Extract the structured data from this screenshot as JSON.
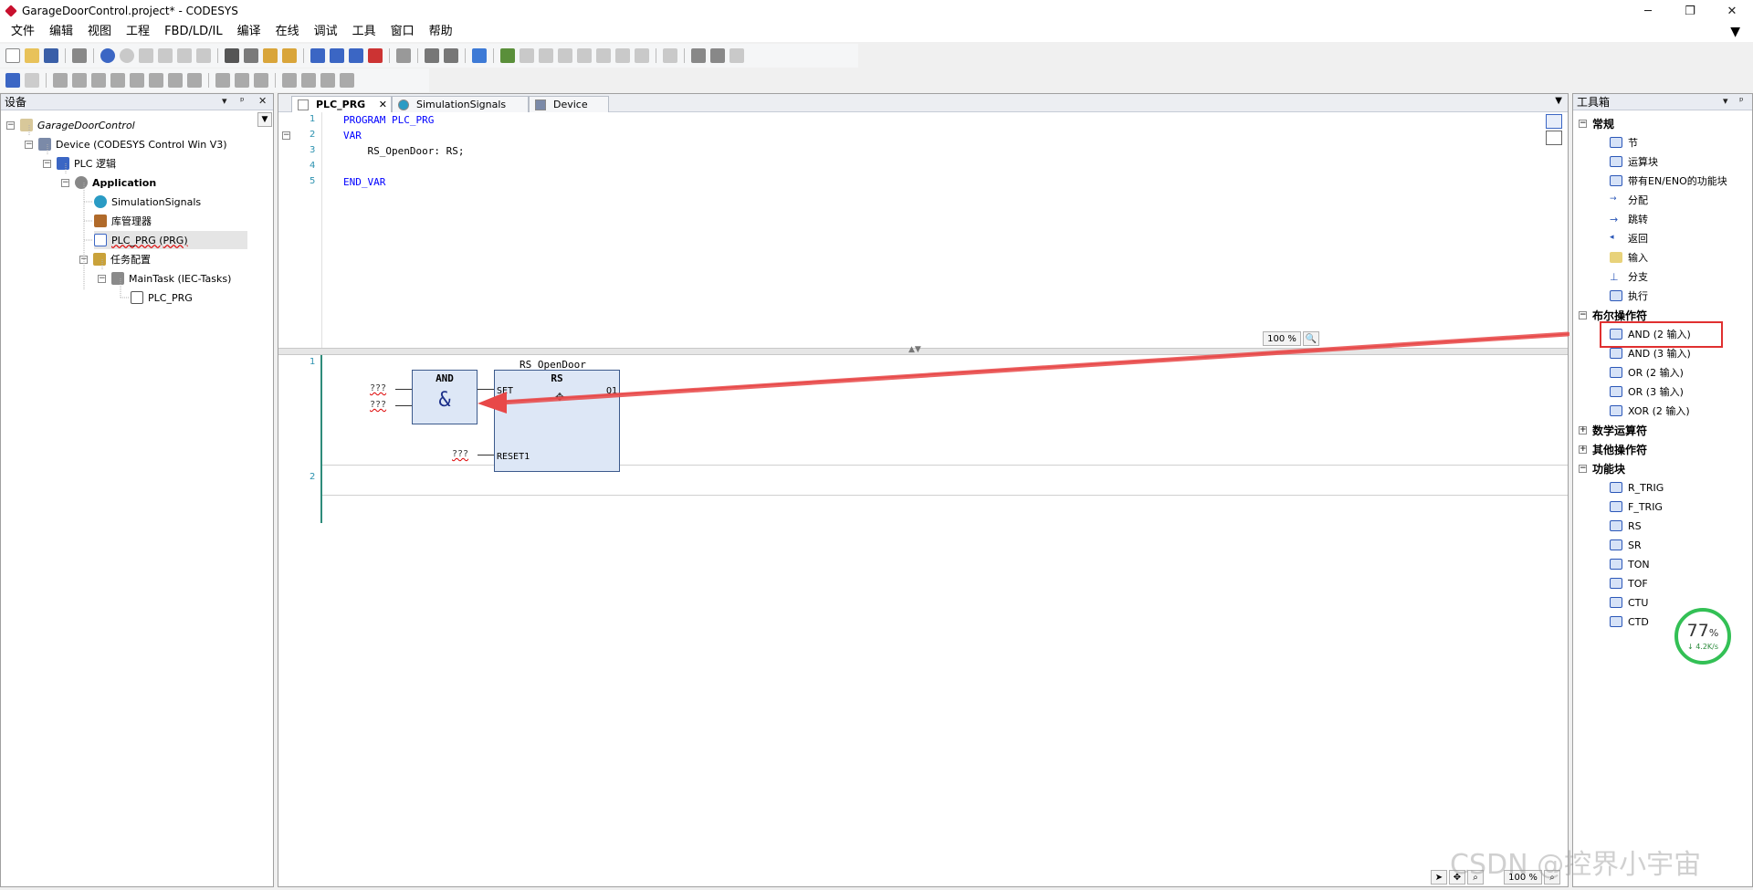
{
  "window": {
    "title": "GarageDoorControl.project* - CODESYS",
    "minimize": "─",
    "maximize": "❐",
    "close": "✕"
  },
  "menu": [
    "文件",
    "编辑",
    "视图",
    "工程",
    "FBD/LD/IL",
    "编译",
    "在线",
    "调试",
    "工具",
    "窗口",
    "帮助"
  ],
  "devices": {
    "title": "设备",
    "tree": [
      {
        "label": "GarageDoorControl",
        "style": "italic"
      },
      {
        "label": "Device (CODESYS Control Win V3)"
      },
      {
        "label": "PLC 逻辑"
      },
      {
        "label": "Application",
        "style": "bold"
      },
      {
        "label": "SimulationSignals"
      },
      {
        "label": "库管理器"
      },
      {
        "label": "PLC_PRG (PRG)"
      },
      {
        "label": "任务配置"
      },
      {
        "label": "MainTask (IEC-Tasks)"
      },
      {
        "label": "PLC_PRG"
      }
    ]
  },
  "editor": {
    "tabs": [
      {
        "label": "PLC_PRG",
        "active": true
      },
      {
        "label": "SimulationSignals"
      },
      {
        "label": "Device"
      }
    ],
    "declaration": {
      "line_numbers": [
        "1",
        "2",
        "3",
        "4",
        "5"
      ],
      "lines": [
        "PROGRAM PLC_PRG",
        "VAR",
        "    RS_OpenDoor: RS;",
        "",
        "END_VAR"
      ]
    },
    "zoom_top": "100 %",
    "networks": [
      "1",
      "2"
    ],
    "instance_name": "RS_OpenDoor",
    "and_block": {
      "title": "AND",
      "symbol": "&"
    },
    "rs_block": {
      "title": "RS",
      "set_pin": "SET",
      "reset_pin": "RESET1",
      "out_pin": "Q1"
    },
    "placeholder": "???",
    "zoom_bottom": "100 %"
  },
  "toolbox": {
    "title": "工具箱",
    "categories": [
      {
        "label": "常规",
        "expanded": true,
        "items": [
          "节",
          "运算块",
          "带有EN/ENO的功能块",
          "分配",
          "跳转",
          "返回",
          "输入",
          "分支",
          "执行"
        ]
      },
      {
        "label": "布尔操作符",
        "expanded": true,
        "items": [
          "AND (2 输入)",
          "AND (3 输入)",
          "OR (2 输入)",
          "OR (3 输入)",
          "XOR (2 输入)"
        ]
      },
      {
        "label": "数学运算符",
        "expanded": false,
        "items": []
      },
      {
        "label": "其他操作符",
        "expanded": false,
        "items": []
      },
      {
        "label": "功能块",
        "expanded": true,
        "items": [
          "R_TRIG",
          "F_TRIG",
          "RS",
          "SR",
          "TON",
          "TOF",
          "CTU",
          "CTD"
        ]
      }
    ],
    "highlighted_item": "AND (2 输入)"
  },
  "overlay": {
    "gauge_percent": "77",
    "gauge_unit": "%",
    "gauge_rate": "↓ 4.2K/s",
    "watermark": "CSDN @控界小宇宙"
  },
  "colors": {
    "keyword": "#0000ff",
    "fb_fill": "#dde7f6",
    "arrow": "#e84848",
    "gauge": "#33c055"
  }
}
